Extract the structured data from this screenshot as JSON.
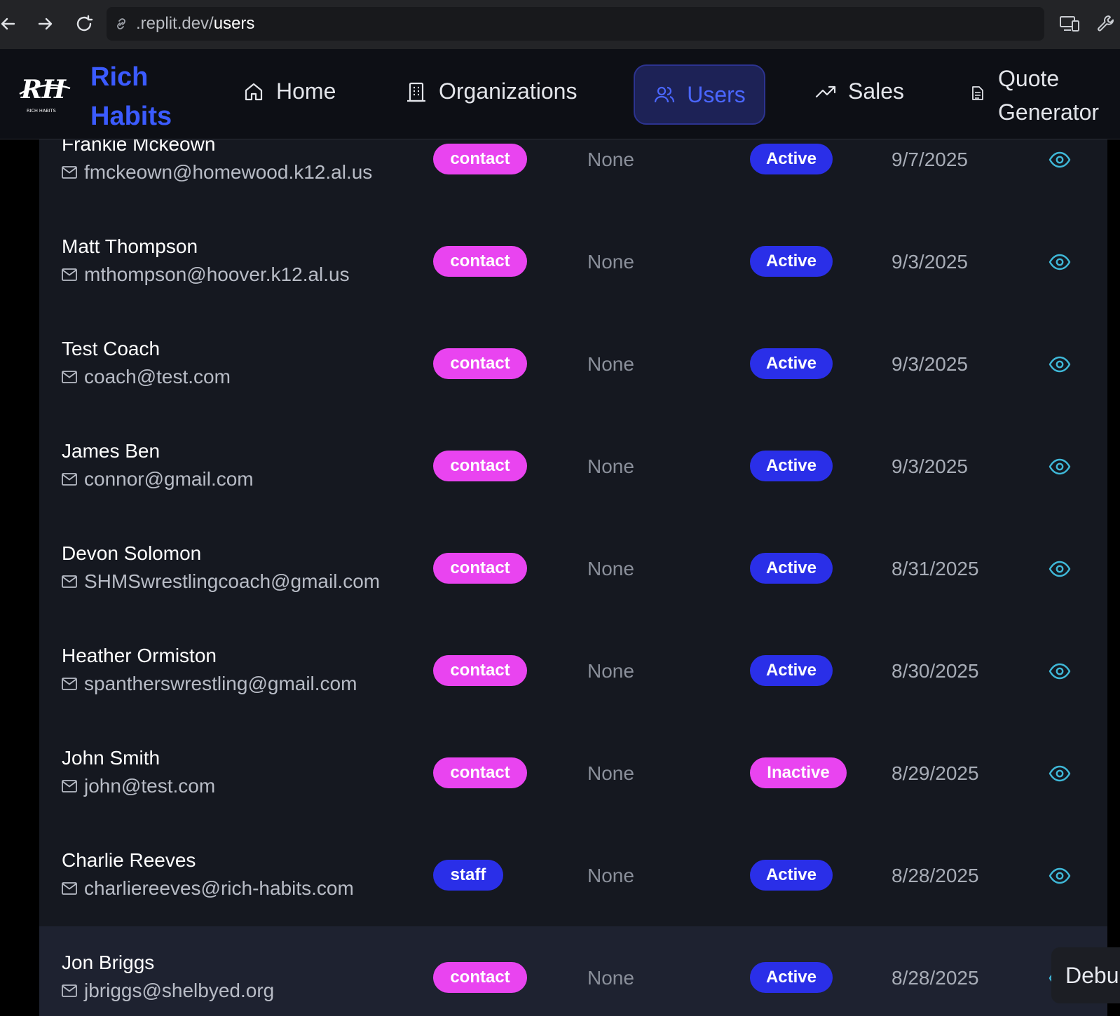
{
  "browser": {
    "url_prefix": ".replit.dev/",
    "url_path": "users"
  },
  "brand": {
    "line1": "Rich",
    "line2": "Habits",
    "logo_text": "RICH HABITS",
    "logo_mark": "RH"
  },
  "nav": {
    "home": "Home",
    "organizations": "Organizations",
    "users": "Users",
    "sales": "Sales",
    "quote_line1": "Quote",
    "quote_line2": "Generator"
  },
  "rows": [
    {
      "name": "Frankie Mckeown",
      "email": "fmckeown@homewood.k12.al.us",
      "role": "contact",
      "org": "None",
      "status": "Active",
      "date": "9/7/2025"
    },
    {
      "name": "Matt Thompson",
      "email": "mthompson@hoover.k12.al.us",
      "role": "contact",
      "org": "None",
      "status": "Active",
      "date": "9/3/2025"
    },
    {
      "name": "Test Coach",
      "email": "coach@test.com",
      "role": "contact",
      "org": "None",
      "status": "Active",
      "date": "9/3/2025"
    },
    {
      "name": "James Ben",
      "email": "connor@gmail.com",
      "role": "contact",
      "org": "None",
      "status": "Active",
      "date": "9/3/2025"
    },
    {
      "name": "Devon Solomon",
      "email": "SHMSwrestlingcoach@gmail.com",
      "role": "contact",
      "org": "None",
      "status": "Active",
      "date": "8/31/2025"
    },
    {
      "name": "Heather Ormiston",
      "email": "spantherswrestling@gmail.com",
      "role": "contact",
      "org": "None",
      "status": "Active",
      "date": "8/30/2025"
    },
    {
      "name": "John Smith",
      "email": "john@test.com",
      "role": "contact",
      "org": "None",
      "status": "Inactive",
      "date": "8/29/2025"
    },
    {
      "name": "Charlie Reeves",
      "email": "charliereeves@rich-habits.com",
      "role": "staff",
      "org": "None",
      "status": "Active",
      "date": "8/28/2025"
    },
    {
      "name": "Jon Briggs",
      "email": "jbriggs@shelbyed.org",
      "role": "contact",
      "org": "None",
      "status": "Active",
      "date": "8/28/2025"
    }
  ],
  "debug_label": "Debu",
  "colors": {
    "accent": "#3b5bff",
    "pink": "#e944f0",
    "blue_pill": "#2a2fe8",
    "eye": "#3fb8d8"
  }
}
